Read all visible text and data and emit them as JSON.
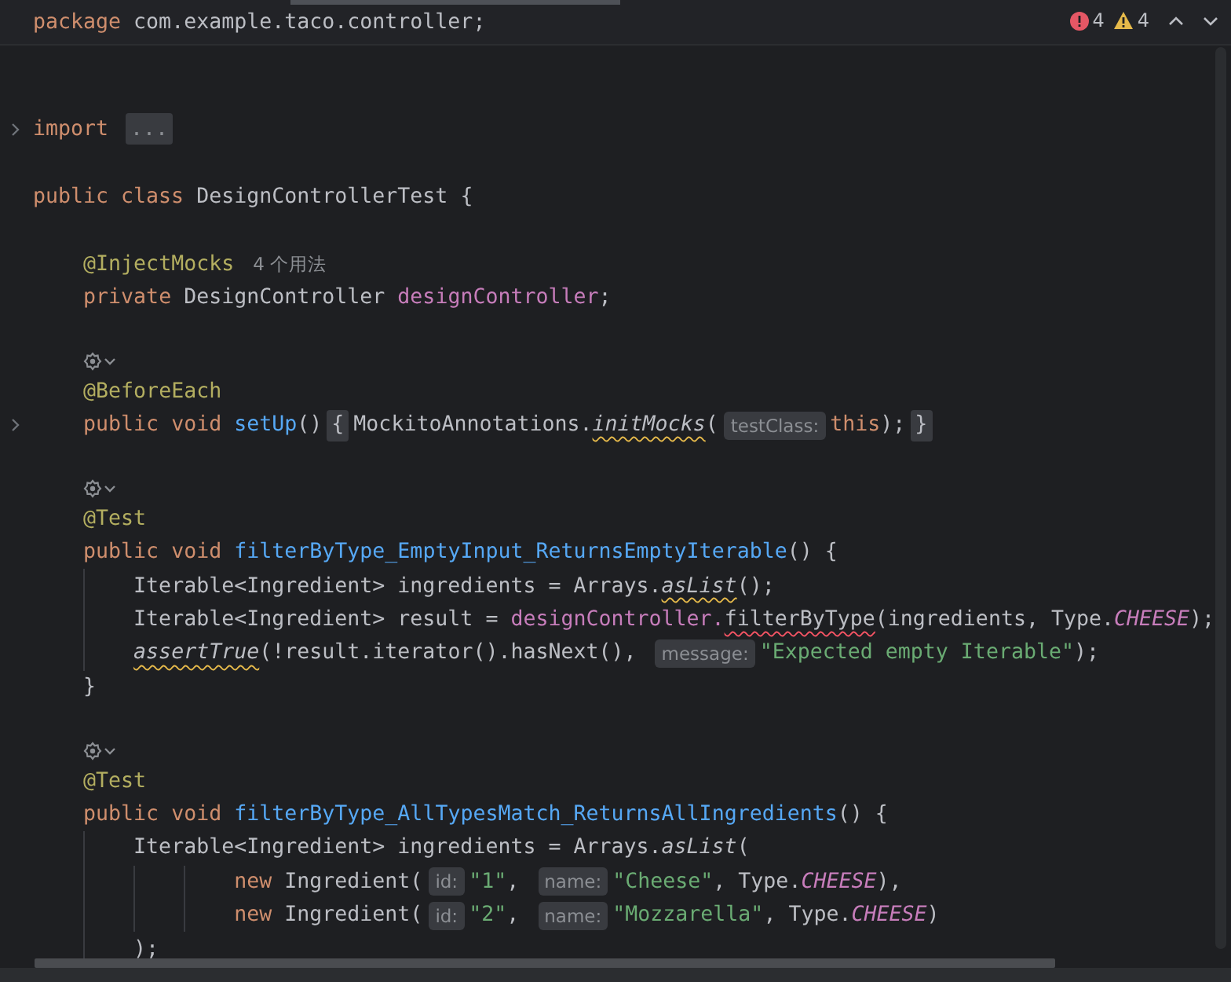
{
  "header": {
    "tokens": [
      {
        "kind": "keyword",
        "text": "package "
      },
      {
        "kind": "plain",
        "text": "com.example.taco.controller;"
      }
    ]
  },
  "problems": {
    "errors": "4",
    "warnings": "4"
  },
  "lines": [
    {
      "kind": "blank"
    },
    {
      "kind": "blank"
    },
    {
      "kind": "code",
      "fold_marker": true,
      "tokens": [
        {
          "kind": "keyword",
          "text": "import "
        },
        {
          "kind": "fold",
          "text": "..."
        }
      ]
    },
    {
      "kind": "blank"
    },
    {
      "kind": "code",
      "fold_marker": false,
      "tokens": [
        {
          "kind": "keyword",
          "text": "public class "
        },
        {
          "kind": "plain",
          "text": "DesignControllerTest {"
        }
      ]
    },
    {
      "kind": "blank"
    },
    {
      "kind": "code",
      "fold_marker": false,
      "tokens": [
        {
          "kind": "annotation",
          "text": "    @InjectMocks"
        },
        {
          "kind": "usage",
          "text": "4 个用法"
        }
      ]
    },
    {
      "kind": "code",
      "fold_marker": false,
      "tokens": [
        {
          "kind": "keyword",
          "text": "    private "
        },
        {
          "kind": "plain",
          "text": "DesignController "
        },
        {
          "kind": "field",
          "text": "designController"
        },
        {
          "kind": "plain",
          "text": ";"
        }
      ]
    },
    {
      "kind": "blank"
    },
    {
      "kind": "inlay"
    },
    {
      "kind": "code",
      "fold_marker": false,
      "tokens": [
        {
          "kind": "annotation",
          "text": "    @BeforeEach"
        }
      ]
    },
    {
      "kind": "code",
      "fold_marker": true,
      "tokens": [
        {
          "kind": "keyword",
          "text": "    public void "
        },
        {
          "kind": "method",
          "text": "setUp"
        },
        {
          "kind": "plain",
          "text": "()"
        },
        {
          "kind": "fold",
          "text": "{"
        },
        {
          "kind": "plain",
          "text": "MockitoAnnotations."
        },
        {
          "kind": "static",
          "text": "initMocks",
          "warning_underline": true
        },
        {
          "kind": "plain",
          "text": "("
        },
        {
          "kind": "hint",
          "text": "testClass:"
        },
        {
          "kind": "keyword",
          "text": "this"
        },
        {
          "kind": "plain",
          "text": ");"
        },
        {
          "kind": "fold",
          "text": "}"
        }
      ]
    },
    {
      "kind": "blank"
    },
    {
      "kind": "inlay"
    },
    {
      "kind": "code",
      "fold_marker": false,
      "tokens": [
        {
          "kind": "annotation",
          "text": "    @Test"
        }
      ]
    },
    {
      "kind": "code",
      "fold_marker": false,
      "tokens": [
        {
          "kind": "keyword",
          "text": "    public void "
        },
        {
          "kind": "method",
          "text": "filterByType_EmptyInput_ReturnsEmptyIterable"
        },
        {
          "kind": "plain",
          "text": "() {"
        }
      ]
    },
    {
      "kind": "code",
      "fold_marker": false,
      "tokens": [
        {
          "kind": "plain",
          "text": "        Iterable<Ingredient> ingredients = Arrays."
        },
        {
          "kind": "static",
          "text": "asList",
          "warning_underline": true
        },
        {
          "kind": "plain",
          "text": "();"
        }
      ]
    },
    {
      "kind": "code",
      "fold_marker": false,
      "tokens": [
        {
          "kind": "plain",
          "text": "        Iterable<Ingredient> result = "
        },
        {
          "kind": "field",
          "text": "designController."
        },
        {
          "kind": "plain",
          "text": "filterByType",
          "error_underline": true
        },
        {
          "kind": "plain",
          "text": "(ingredients, Type."
        },
        {
          "kind": "constant",
          "text": "CHEESE"
        },
        {
          "kind": "plain",
          "text": ");"
        }
      ]
    },
    {
      "kind": "code",
      "fold_marker": false,
      "tokens": [
        {
          "kind": "static",
          "text": "        assertTrue",
          "warning_underline": true
        },
        {
          "kind": "plain",
          "text": "(!result.iterator().hasNext(), "
        },
        {
          "kind": "hint",
          "text": "message:"
        },
        {
          "kind": "string",
          "text": "\"Expected empty Iterable\""
        },
        {
          "kind": "plain",
          "text": ");"
        }
      ]
    },
    {
      "kind": "code",
      "fold_marker": false,
      "tokens": [
        {
          "kind": "plain",
          "text": "    }"
        }
      ]
    },
    {
      "kind": "blank"
    },
    {
      "kind": "inlay"
    },
    {
      "kind": "code",
      "fold_marker": false,
      "tokens": [
        {
          "kind": "annotation",
          "text": "    @Test"
        }
      ]
    },
    {
      "kind": "code",
      "fold_marker": false,
      "tokens": [
        {
          "kind": "keyword",
          "text": "    public void "
        },
        {
          "kind": "method",
          "text": "filterByType_AllTypesMatch_ReturnsAllIngredients"
        },
        {
          "kind": "plain",
          "text": "() {"
        }
      ]
    },
    {
      "kind": "code",
      "fold_marker": false,
      "tokens": [
        {
          "kind": "plain",
          "text": "        Iterable<Ingredient> ingredients = Arrays."
        },
        {
          "kind": "static",
          "text": "asList"
        },
        {
          "kind": "plain",
          "text": "("
        }
      ]
    },
    {
      "kind": "code",
      "fold_marker": false,
      "tokens": [
        {
          "kind": "keyword",
          "text": "                new "
        },
        {
          "kind": "plain",
          "text": "Ingredient("
        },
        {
          "kind": "hint",
          "text": "id:"
        },
        {
          "kind": "string",
          "text": "\"1\""
        },
        {
          "kind": "plain",
          "text": ", "
        },
        {
          "kind": "hint",
          "text": "name:"
        },
        {
          "kind": "string",
          "text": "\"Cheese\""
        },
        {
          "kind": "plain",
          "text": ", Type."
        },
        {
          "kind": "constant",
          "text": "CHEESE"
        },
        {
          "kind": "plain",
          "text": "),"
        }
      ]
    },
    {
      "kind": "code",
      "fold_marker": false,
      "tokens": [
        {
          "kind": "keyword",
          "text": "                new "
        },
        {
          "kind": "plain",
          "text": "Ingredient("
        },
        {
          "kind": "hint",
          "text": "id:"
        },
        {
          "kind": "string",
          "text": "\"2\""
        },
        {
          "kind": "plain",
          "text": ", "
        },
        {
          "kind": "hint",
          "text": "name:"
        },
        {
          "kind": "string",
          "text": "\"Mozzarella\""
        },
        {
          "kind": "plain",
          "text": ", Type."
        },
        {
          "kind": "constant",
          "text": "CHEESE"
        },
        {
          "kind": "plain",
          "text": ")"
        }
      ]
    },
    {
      "kind": "code",
      "fold_marker": false,
      "tokens": [
        {
          "kind": "plain",
          "text": "        );"
        }
      ]
    }
  ]
}
